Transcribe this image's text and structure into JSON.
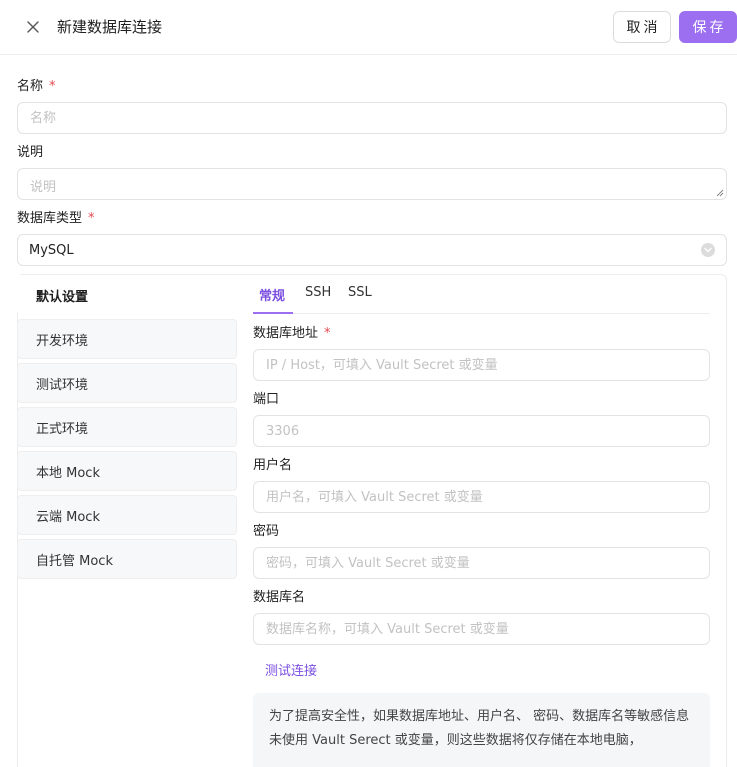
{
  "header": {
    "title": "新建数据库连接",
    "cancel_label": "取消",
    "save_label": "保存",
    "accent": "#9b6ff0"
  },
  "form": {
    "name": {
      "label": "名称",
      "placeholder": "名称",
      "required": "*"
    },
    "desc": {
      "label": "说明",
      "placeholder": "说明"
    },
    "db_type": {
      "label": "数据库类型",
      "required": "*",
      "value": "MySQL"
    }
  },
  "environments": {
    "items": [
      {
        "label": "默认设置",
        "active": true
      },
      {
        "label": "开发环境"
      },
      {
        "label": "测试环境"
      },
      {
        "label": "正式环境"
      },
      {
        "label": "本地 Mock"
      },
      {
        "label": "云端 Mock"
      },
      {
        "label": "自托管 Mock"
      }
    ]
  },
  "tabs": [
    {
      "label": "常规",
      "active": true
    },
    {
      "label": "SSH"
    },
    {
      "label": "SSL"
    }
  ],
  "general": {
    "host": {
      "label": "数据库地址",
      "required": "*",
      "placeholder": "IP / Host，可填入 Vault Secret 或变量"
    },
    "port": {
      "label": "端口",
      "placeholder": "3306"
    },
    "user": {
      "label": "用户名",
      "placeholder": "用户名，可填入 Vault Secret 或变量"
    },
    "password": {
      "label": "密码",
      "placeholder": "密码，可填入 Vault Secret 或变量"
    },
    "dbname": {
      "label": "数据库名",
      "placeholder": "数据库名称，可填入 Vault Secret 或变量"
    },
    "test_link": "测试连接",
    "notice": "为了提高安全性，如果数据库地址、用户名、 密码、数据库名等敏感信息未使用 Vault Serect 或变量，则这些数据将仅存储在本地电脑，"
  }
}
